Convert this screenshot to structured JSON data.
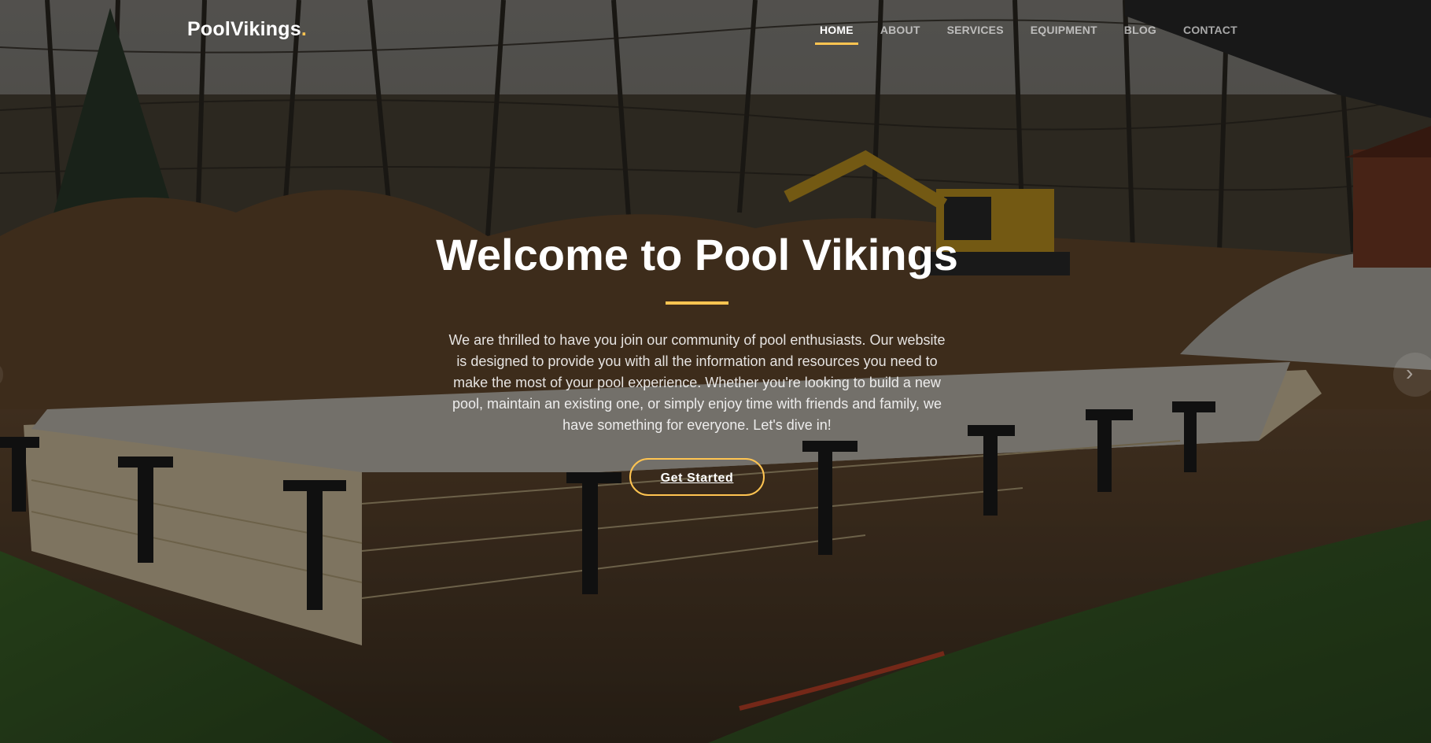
{
  "brand": {
    "name": "PoolVikings",
    "dot": ".",
    "accent_color": "#ffc451"
  },
  "nav": {
    "items": [
      {
        "label": "HOME",
        "active": true
      },
      {
        "label": "ABOUT",
        "active": false
      },
      {
        "label": "SERVICES",
        "active": false
      },
      {
        "label": "EQUIPMENT",
        "active": false
      },
      {
        "label": "BLOG",
        "active": false
      },
      {
        "label": "CONTACT",
        "active": false
      }
    ]
  },
  "hero": {
    "title": "Welcome to Pool Vikings",
    "text": "We are thrilled to have you join our community of pool enthusiasts. Our website is designed to provide you with all the information and resources you need to make the most of your pool experience. Whether you're looking to build a new pool, maintain an existing one, or simply enjoy time with friends and family, we have something for everyone. Let's dive in!",
    "cta_label": "Get Started"
  },
  "carousel": {
    "next_icon": "chevron-right-icon",
    "prev_icon": "chevron-left-icon"
  }
}
